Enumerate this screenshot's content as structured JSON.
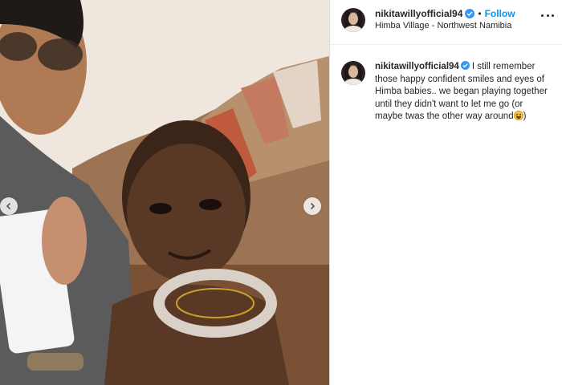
{
  "post": {
    "username": "nikitawillyofficial94",
    "follow_label": "Follow",
    "separator": "•",
    "location": "Himba Village - Northwest Namibia"
  },
  "caption": {
    "username": "nikitawillyofficial94",
    "text_before_emoji": "I still remember those happy confident smiles and eyes of Himba babies.. we began playing together until they didn't want to let me go (or maybe twas the other way around",
    "text_after_emoji": ")"
  },
  "icons": {
    "verified": "verified-badge-icon",
    "more": "more-options-icon",
    "prev": "chevron-left-icon",
    "next": "chevron-right-icon",
    "emoji": "laughing-emoji-icon"
  },
  "colors": {
    "link_blue": "#0095f6",
    "verified_blue": "#3897f0",
    "text": "#262626",
    "border": "#dbdbdb"
  }
}
